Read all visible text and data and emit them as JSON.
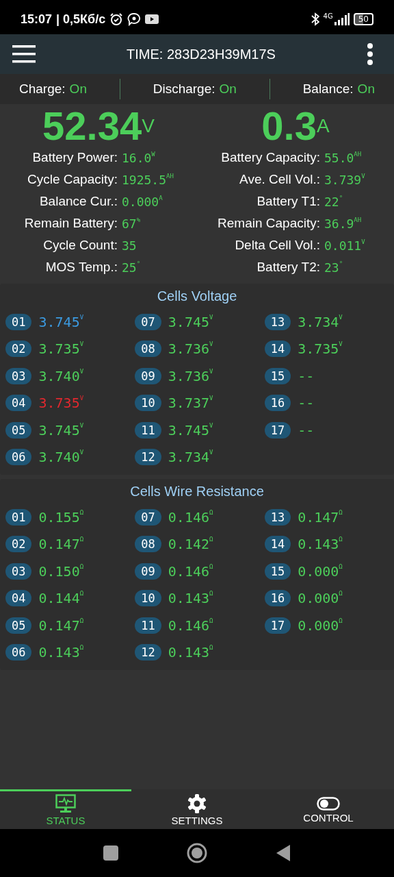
{
  "status_bar": {
    "time": "15:07",
    "speed": "| 0,5Кб/с",
    "network": "4G",
    "battery": "50"
  },
  "app_bar": {
    "title": "TIME: 283D23H39M17S"
  },
  "switches": [
    {
      "label": "Charge:",
      "state": "On",
      "on": true
    },
    {
      "label": "Discharge:",
      "state": "On",
      "on": true
    },
    {
      "label": "Balance:",
      "state": "On",
      "on": true
    }
  ],
  "main": {
    "voltage": {
      "value": "52.34",
      "unit": "V"
    },
    "current": {
      "value": "0.3",
      "unit": "A"
    }
  },
  "stats_left": [
    {
      "label": "Battery Power:",
      "value": "16.0",
      "unit": "W"
    },
    {
      "label": "Cycle Capacity:",
      "value": "1925.5",
      "unit": "AH"
    },
    {
      "label": "Balance Cur.:",
      "value": "0.000",
      "unit": "A"
    },
    {
      "label": "Remain Battery:",
      "value": "67",
      "unit": "%"
    },
    {
      "label": "Cycle Count:",
      "value": "35"
    },
    {
      "label": "MOS Temp.:",
      "value": "25",
      "unit": "°"
    }
  ],
  "stats_right": [
    {
      "label": "Battery Capacity:",
      "value": "55.0",
      "unit": "AH"
    },
    {
      "label": "Ave. Cell Vol.:",
      "value": "3.739",
      "unit": "V"
    },
    {
      "label": "Battery T1:",
      "value": "22",
      "unit": "°"
    },
    {
      "label": "Remain Capacity:",
      "value": "36.9",
      "unit": "AH"
    },
    {
      "label": "Delta Cell Vol.:",
      "value": "0.011",
      "unit": "V"
    },
    {
      "label": "Battery T2:",
      "value": "23",
      "unit": "°"
    }
  ],
  "sections": [
    {
      "title": "Cells Voltage",
      "cells": [
        {
          "index": "01",
          "value": "3.745",
          "unit": "V",
          "color": "#3b9ae0"
        },
        {
          "index": "02",
          "value": "3.735",
          "unit": "V",
          "color": "#4cce5a"
        },
        {
          "index": "03",
          "value": "3.740",
          "unit": "V",
          "color": "#4cce5a"
        },
        {
          "index": "04",
          "value": "3.735",
          "unit": "V",
          "color": "#e0282e"
        },
        {
          "index": "05",
          "value": "3.745",
          "unit": "V",
          "color": "#4cce5a"
        },
        {
          "index": "06",
          "value": "3.740",
          "unit": "V",
          "color": "#4cce5a"
        },
        {
          "index": "07",
          "value": "3.745",
          "unit": "V",
          "color": "#4cce5a"
        },
        {
          "index": "08",
          "value": "3.736",
          "unit": "V",
          "color": "#4cce5a"
        },
        {
          "index": "09",
          "value": "3.736",
          "unit": "V",
          "color": "#4cce5a"
        },
        {
          "index": "10",
          "value": "3.737",
          "unit": "V",
          "color": "#4cce5a"
        },
        {
          "index": "11",
          "value": "3.745",
          "unit": "V",
          "color": "#4cce5a"
        },
        {
          "index": "12",
          "value": "3.734",
          "unit": "V",
          "color": "#4cce5a"
        },
        {
          "index": "13",
          "value": "3.734",
          "unit": "V",
          "color": "#4cce5a"
        },
        {
          "index": "14",
          "value": "3.735",
          "unit": "V",
          "color": "#4cce5a"
        },
        {
          "index": "15",
          "value": "--",
          "color": "#4cce5a"
        },
        {
          "index": "16",
          "value": "--",
          "color": "#4cce5a"
        },
        {
          "index": "17",
          "value": "--",
          "color": "#4cce5a"
        }
      ]
    },
    {
      "title": "Cells Wire Resistance",
      "cells": [
        {
          "index": "01",
          "value": "0.155",
          "unit": "Ω"
        },
        {
          "index": "02",
          "value": "0.147",
          "unit": "Ω"
        },
        {
          "index": "03",
          "value": "0.150",
          "unit": "Ω"
        },
        {
          "index": "04",
          "value": "0.144",
          "unit": "Ω"
        },
        {
          "index": "05",
          "value": "0.147",
          "unit": "Ω"
        },
        {
          "index": "06",
          "value": "0.143",
          "unit": "Ω"
        },
        {
          "index": "07",
          "value": "0.146",
          "unit": "Ω"
        },
        {
          "index": "08",
          "value": "0.142",
          "unit": "Ω"
        },
        {
          "index": "09",
          "value": "0.146",
          "unit": "Ω"
        },
        {
          "index": "10",
          "value": "0.143",
          "unit": "Ω"
        },
        {
          "index": "11",
          "value": "0.146",
          "unit": "Ω"
        },
        {
          "index": "12",
          "value": "0.143",
          "unit": "Ω"
        },
        {
          "index": "13",
          "value": "0.147",
          "unit": "Ω"
        },
        {
          "index": "14",
          "value": "0.143",
          "unit": "Ω"
        },
        {
          "index": "15",
          "value": "0.000",
          "unit": "Ω"
        },
        {
          "index": "16",
          "value": "0.000",
          "unit": "Ω"
        },
        {
          "index": "17",
          "value": "0.000",
          "unit": "Ω"
        }
      ]
    }
  ],
  "tabs": [
    {
      "label": "STATUS",
      "kind": "status",
      "selected": true
    },
    {
      "label": "SETTINGS",
      "kind": "settings",
      "selected": false
    },
    {
      "label": "CONTROL",
      "kind": "control",
      "selected": false
    }
  ]
}
